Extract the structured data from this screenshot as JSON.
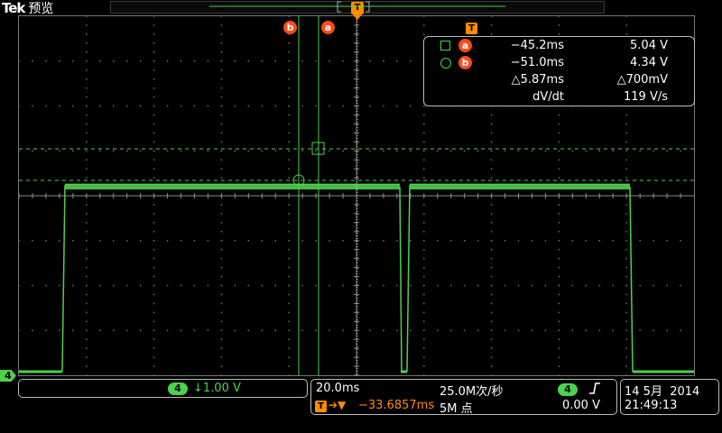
{
  "header": {
    "brand": "Tek",
    "app_name": "预览"
  },
  "cursors": {
    "a": {
      "label": "a",
      "time": "−45.2ms",
      "voltage": "5.04 V"
    },
    "b": {
      "label": "b",
      "time": "−51.0ms",
      "voltage": "4.34 V"
    },
    "delta_time": "△5.87ms",
    "delta_voltage": "△700mV",
    "slope_label": "dV/dt",
    "slope_value": "119 V/s"
  },
  "trigger": {
    "label": "T",
    "position": "−33.6857ms"
  },
  "channel4": {
    "number": "4",
    "scale": "↓1.00 V",
    "marker": "4"
  },
  "timebase": {
    "scale": "20.0ms",
    "sample_rate": "25.0M次/秒",
    "record_length": "5M 点"
  },
  "trigger_settings": {
    "source": "4",
    "slope_icon": "rising-edge-icon",
    "level": "0.00 V"
  },
  "datetime": {
    "date": "14 5月  2014",
    "time": "21:49:13"
  },
  "colors": {
    "trace": "#4cd24c",
    "cursor_badge": "#ff4a1a",
    "trigger": "#ff8c00",
    "grid": "#7a7a7a"
  }
}
